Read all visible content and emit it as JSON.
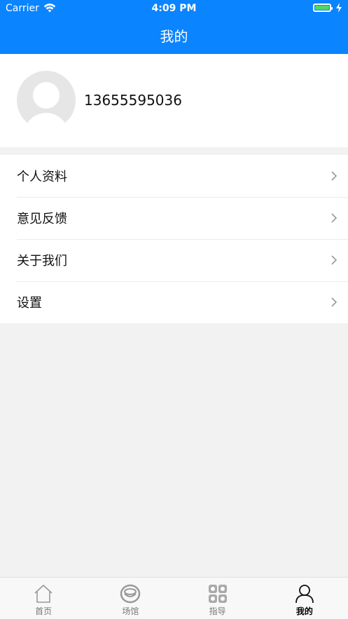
{
  "status_bar": {
    "carrier": "Carrier",
    "time": "4:09 PM"
  },
  "header": {
    "title": "我的"
  },
  "profile": {
    "phone": "13655595036"
  },
  "menu": {
    "items": [
      {
        "label": "个人资料"
      },
      {
        "label": "意见反馈"
      },
      {
        "label": "关于我们"
      },
      {
        "label": "设置"
      }
    ]
  },
  "tabbar": {
    "tabs": [
      {
        "label": "首页",
        "icon": "home-icon",
        "active": false
      },
      {
        "label": "场馆",
        "icon": "venue-icon",
        "active": false
      },
      {
        "label": "指导",
        "icon": "grid-icon",
        "active": false
      },
      {
        "label": "我的",
        "icon": "user-icon",
        "active": true
      }
    ]
  },
  "colors": {
    "primary": "#0a84ff",
    "background": "#f2f2f2",
    "battery": "#4cd964"
  }
}
